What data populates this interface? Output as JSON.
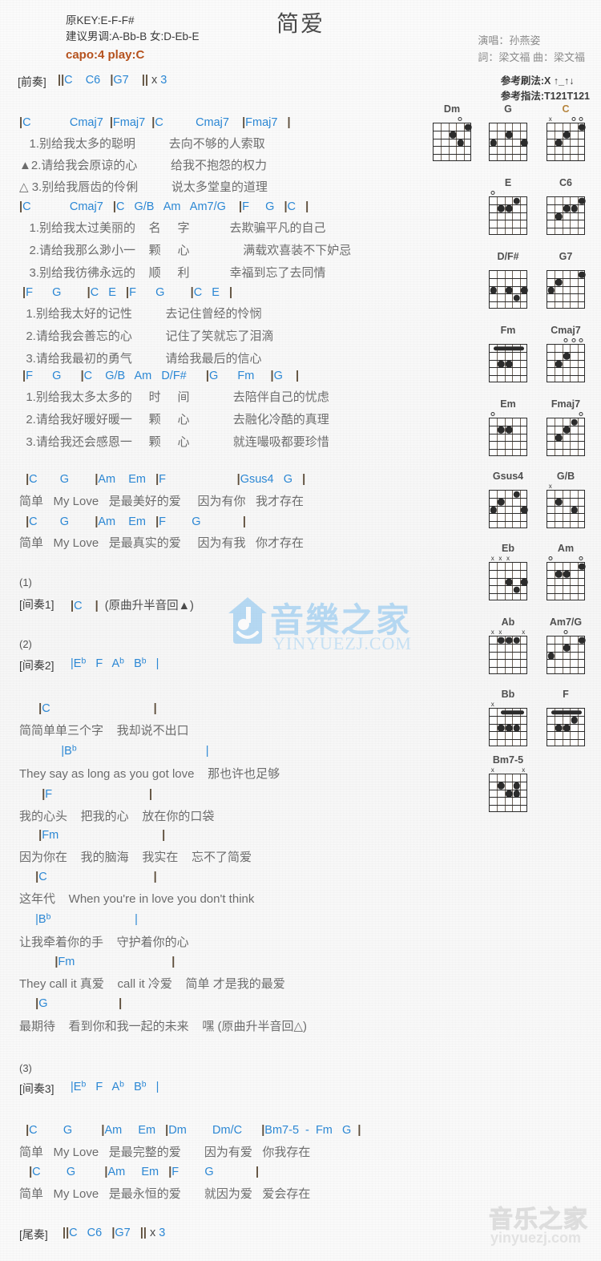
{
  "header": {
    "title": "简爱",
    "orig_key": "原KEY:E-F-F#",
    "suggest_key": "建议男调:A-Bb-B 女:D-Eb-E",
    "capo": "capo:4 play:C",
    "singer": "演唱：孙燕姿",
    "writers": "詞：梁文福  曲：梁文福",
    "strum": "参考刷法:X ↑_↑↓",
    "fingering": "参考指法:T121T121"
  },
  "intro": {
    "label": "[前奏]",
    "chords": "||C    C6   |G7    || x 3"
  },
  "verse1": {
    "chordline1": "|C            Cmaj7  |Fmaj7  |C          Cmaj7    |Fmaj7   |",
    "lyrics1": [
      "   1.别给我太多的聪明          去向不够的人索取",
      "▲2.请给我会原谅的心          给我不抱怨的权力",
      "△ 3.别给我唇齿的伶俐          说太多堂皇的道理"
    ],
    "chordline2": "|C            Cmaj7   |C   G/B   Am   Am7/G    |F     G   |C   |",
    "lyrics2": [
      "   1.别给我太过美丽的    名     字            去欺骗平凡的自己",
      "   2.请给我那么渺小一    颗     心                满载欢喜装不下妒忌",
      "   3.别给我彷彿永远的    顺     利            幸福到忘了去同情"
    ],
    "chordline3": " |F      G        |C   E   |F      G        |C   E   |",
    "lyrics3": [
      "  1.别给我太好的记性          去记住曾经的怜悯",
      "  2.请给我会善忘的心          记住了笑就忘了泪滴",
      "  3.请给我最初的勇气          请给我最后的信心"
    ],
    "chordline4": " |F      G      |C    G/B   Am   D/F#      |G      Fm     |G    |",
    "lyrics4": [
      "  1.别给我太多太多的     时     间             去陪伴自己的忧虑",
      "  2.请给我好暖好暖一     颗     心             去融化冷酷的真理",
      "  3.请给我还会感恩一     颗     心             就连嘬吸都要珍惜"
    ]
  },
  "chorus1": {
    "chordline1": "  |C       G        |Am    Em   |F                      |Gsus4   G   |",
    "lyric1": "简单   My Love   是最美好的爱     因为有你   我才存在",
    "chordline2": "  |C       G        |Am    Em   |F        G             |",
    "lyric2": "简单   My Love   是最真实的爱     因为有我   你才存在"
  },
  "interlude1": {
    "num": "(1)",
    "label": "[间奏1]",
    "chords": "|C    |  (原曲升半音回▲)"
  },
  "interlude2": {
    "num": "(2)",
    "label": "[间奏2]",
    "chords": "|Eb   F   Ab   Bb   |"
  },
  "bridge": {
    "lines": [
      {
        "chord": "      |C                                |",
        "lyric": "简简单单三个字    我却说不出口"
      },
      {
        "chord": "             |Bb                                        |",
        "lyric": "They say as long as you got love    那也许也足够"
      },
      {
        "chord": "       |F                              |",
        "lyric": "我的心头    把我的心    放在你的口袋"
      },
      {
        "chord": "      |Fm                                |",
        "lyric": "因为你在    我的脑海    我实在    忘不了简爱"
      },
      {
        "chord": "     |C                                 |",
        "lyric": "这年代    When you're in love you don't think"
      },
      {
        "chord": "     |Bb                          |",
        "lyric": "让我牵着你的手    守护着你的心"
      },
      {
        "chord": "           |Fm                              |",
        "lyric": "They call it 真爱    call it 冷爱    简单 才是我的最爱"
      },
      {
        "chord": "     |G                      |",
        "lyric": "最期待    看到你和我一起的未来    嘿 (原曲升半音回△)"
      }
    ]
  },
  "interlude3": {
    "num": "(3)",
    "label": "[间奏3]",
    "chords": "|Eb   F   Ab   Bb   |"
  },
  "chorus2": {
    "chordline1": "  |C        G         |Am     Em   |Dm        Dm/C      |Bm7-5  -  Fm   G  |",
    "lyric1": "简单   My Love   是最完整的爱       因为有爱   你我存在",
    "chordline2": "   |C        G         |Am     Em   |F        G             |",
    "lyric2": "简单   My Love   是最永恒的爱       就因为爱   爱会存在"
  },
  "outro": {
    "label": "[尾奏]",
    "chords": "||C   C6   |G7   || x 3"
  },
  "watermark": {
    "main_cn": "音樂之家",
    "main_en": "YINYUEZJ.COM",
    "corner_cn": "音乐之家",
    "corner_en": "yinyuezj.com"
  },
  "colors": {
    "chord": "#2b87d4",
    "capo": "#b5521e",
    "lyric": "#6c6c6c",
    "bar": "#5d4d3a"
  },
  "chord_diagrams": [
    {
      "name": "Dm",
      "markers": [
        {
          "t": "o",
          "s": 3
        }
      ],
      "dots": [
        {
          "s": 4,
          "f": 1
        },
        {
          "s": 2,
          "f": 2
        },
        {
          "s": 3,
          "f": 3
        }
      ],
      "barre": null,
      "amber": false
    },
    {
      "name": "G",
      "markers": [],
      "dots": [
        {
          "s": 0,
          "f": 3
        },
        {
          "s": 2,
          "f": 2
        },
        {
          "s": 4,
          "f": 3
        }
      ],
      "barre": null,
      "amber": false
    },
    {
      "name": "C",
      "markers": [
        {
          "t": "x",
          "s": 0
        },
        {
          "t": "o",
          "s": 3
        },
        {
          "t": "o",
          "s": 4
        }
      ],
      "dots": [
        {
          "s": 1,
          "f": 3
        },
        {
          "s": 2,
          "f": 2
        },
        {
          "s": 4,
          "f": 1
        }
      ],
      "barre": null,
      "amber": true
    },
    {
      "name": "E",
      "markers": [
        {
          "t": "o",
          "s": 0
        }
      ],
      "dots": [
        {
          "s": 1,
          "f": 2
        },
        {
          "s": 2,
          "f": 2
        },
        {
          "s": 3,
          "f": 1
        }
      ],
      "barre": null,
      "amber": false
    },
    {
      "name": "C6",
      "markers": [],
      "dots": [
        {
          "s": 1,
          "f": 3
        },
        {
          "s": 2,
          "f": 2
        },
        {
          "s": 3,
          "f": 2
        },
        {
          "s": 4,
          "f": 1
        }
      ],
      "barre": null,
      "amber": false
    },
    {
      "name": "D/F#",
      "markers": [],
      "dots": [
        {
          "s": 0,
          "f": 3
        },
        {
          "s": 2,
          "f": 3
        },
        {
          "s": 3,
          "f": 4
        },
        {
          "s": 4,
          "f": 3
        }
      ],
      "barre": null,
      "amber": false
    },
    {
      "name": "G7",
      "markers": [],
      "dots": [
        {
          "s": 0,
          "f": 3
        },
        {
          "s": 1,
          "f": 2
        },
        {
          "s": 4,
          "f": 1
        }
      ],
      "barre": null,
      "amber": false
    },
    {
      "name": "Fm",
      "markers": [],
      "dots": [
        {
          "s": 1,
          "f": 3
        },
        {
          "s": 2,
          "f": 3
        }
      ],
      "barre": {
        "f": 1,
        "from": 0,
        "to": 4
      },
      "amber": false
    },
    {
      "name": "Cmaj7",
      "markers": [
        {
          "t": "o",
          "s": 2
        },
        {
          "t": "o",
          "s": 3
        },
        {
          "t": "o",
          "s": 4
        }
      ],
      "dots": [
        {
          "s": 1,
          "f": 3
        },
        {
          "s": 2,
          "f": 2
        }
      ],
      "barre": null,
      "amber": false
    },
    {
      "name": "Em",
      "markers": [
        {
          "t": "o",
          "s": 0
        }
      ],
      "dots": [
        {
          "s": 1,
          "f": 2
        },
        {
          "s": 2,
          "f": 2
        }
      ],
      "barre": null,
      "amber": false
    },
    {
      "name": "Fmaj7",
      "markers": [
        {
          "t": "o",
          "s": 4
        }
      ],
      "dots": [
        {
          "s": 1,
          "f": 3
        },
        {
          "s": 2,
          "f": 2
        },
        {
          "s": 3,
          "f": 1
        }
      ],
      "barre": null,
      "amber": false
    },
    {
      "name": "Gsus4",
      "markers": [],
      "dots": [
        {
          "s": 0,
          "f": 3
        },
        {
          "s": 1,
          "f": 2
        },
        {
          "s": 3,
          "f": 1
        },
        {
          "s": 4,
          "f": 3
        }
      ],
      "barre": null,
      "amber": false
    },
    {
      "name": "G/B",
      "markers": [
        {
          "t": "x",
          "s": 0
        }
      ],
      "dots": [
        {
          "s": 1,
          "f": 2
        },
        {
          "s": 3,
          "f": 3
        }
      ],
      "barre": null,
      "amber": false
    },
    {
      "name": "Eb",
      "markers": [
        {
          "t": "x",
          "s": 0
        },
        {
          "t": "x",
          "s": 1
        },
        {
          "t": "x",
          "s": 2
        }
      ],
      "dots": [
        {
          "s": 2,
          "f": 3
        },
        {
          "s": 3,
          "f": 4
        },
        {
          "s": 4,
          "f": 3
        }
      ],
      "barre": null,
      "amber": false
    },
    {
      "name": "Am",
      "markers": [
        {
          "t": "o",
          "s": 0
        },
        {
          "t": "o",
          "s": 4
        }
      ],
      "dots": [
        {
          "s": 1,
          "f": 2
        },
        {
          "s": 2,
          "f": 2
        },
        {
          "s": 4,
          "f": 1
        }
      ],
      "barre": null,
      "amber": false
    },
    {
      "name": "Ab",
      "markers": [
        {
          "t": "x",
          "s": 0
        },
        {
          "t": "x",
          "s": 1
        },
        {
          "t": "x",
          "s": 4
        }
      ],
      "dots": [
        {
          "s": 1,
          "f": 1
        },
        {
          "s": 2,
          "f": 1
        },
        {
          "s": 3,
          "f": 1
        }
      ],
      "barre": null,
      "amber": false
    },
    {
      "name": "Am7/G",
      "markers": [
        {
          "t": "o",
          "s": 2
        }
      ],
      "dots": [
        {
          "s": 0,
          "f": 3
        },
        {
          "s": 2,
          "f": 2
        },
        {
          "s": 4,
          "f": 1
        }
      ],
      "barre": null,
      "amber": false
    },
    {
      "name": "Bb",
      "markers": [
        {
          "t": "x",
          "s": 0
        }
      ],
      "dots": [
        {
          "s": 1,
          "f": 3
        },
        {
          "s": 2,
          "f": 3
        },
        {
          "s": 3,
          "f": 3
        }
      ],
      "barre": {
        "f": 1,
        "from": 1,
        "to": 4
      },
      "amber": false
    },
    {
      "name": "F",
      "markers": [],
      "dots": [
        {
          "s": 1,
          "f": 3
        },
        {
          "s": 2,
          "f": 3
        },
        {
          "s": 3,
          "f": 2
        }
      ],
      "barre": {
        "f": 1,
        "from": 0,
        "to": 4
      },
      "amber": false
    },
    {
      "name": "Bm7-5",
      "markers": [
        {
          "t": "x",
          "s": 0
        },
        {
          "t": "x",
          "s": 4
        }
      ],
      "dots": [
        {
          "s": 1,
          "f": 2
        },
        {
          "s": 2,
          "f": 3
        },
        {
          "s": 3,
          "f": 2
        },
        {
          "s": 3,
          "f": 3
        }
      ],
      "barre": null,
      "amber": false
    }
  ]
}
